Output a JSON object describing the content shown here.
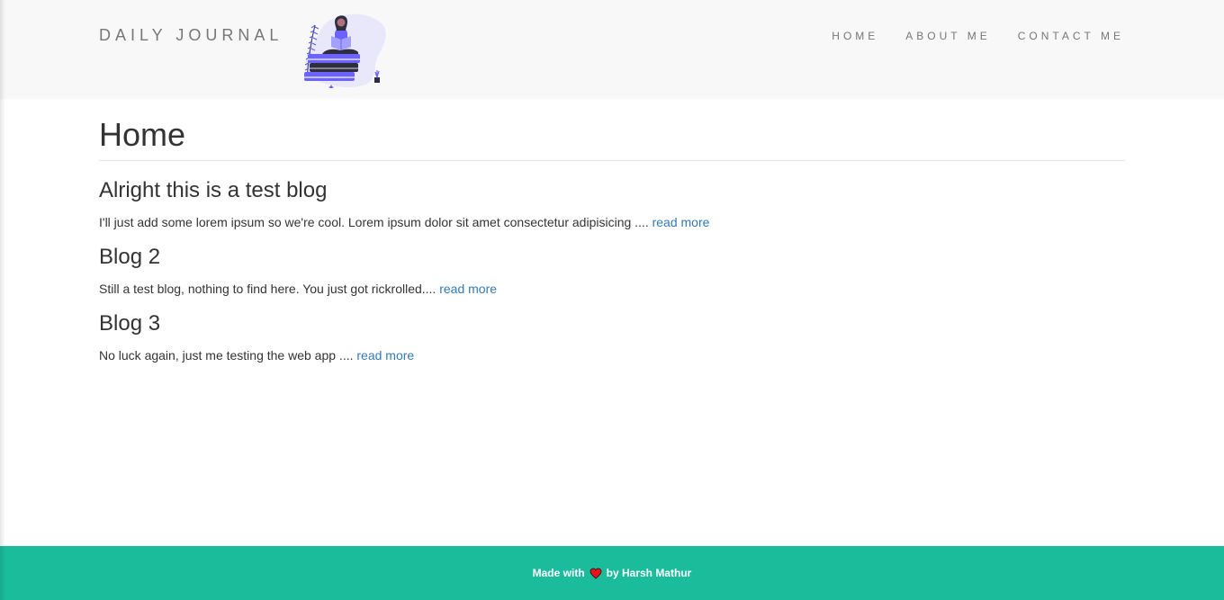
{
  "navbar": {
    "brand": "DAILY JOURNAL",
    "links": [
      "HOME",
      "ABOUT ME",
      "CONTACT ME"
    ]
  },
  "main": {
    "title": "Home",
    "posts": [
      {
        "title": "Alright this is a test blog",
        "excerpt": "I'll just add some lorem ipsum so we're cool. Lorem ipsum dolor sit amet consectetur adipisicing ....",
        "link": "read more"
      },
      {
        "title": "Blog 2",
        "excerpt": "Still a test blog, nothing to find here. You just got rickrolled....",
        "link": "read more"
      },
      {
        "title": "Blog 3",
        "excerpt": "No luck again, just me testing the web app ....",
        "link": "read more"
      }
    ]
  },
  "footer": {
    "prefix": "Made with",
    "suffix": "by Harsh Mathur",
    "icon": "heart-icon"
  },
  "colors": {
    "navbar_bg": "#f8f8f8",
    "footer_bg": "#1abc9c",
    "link": "#337ab7",
    "heart": "#e4161b",
    "illustration_accent": "#6c63ff"
  }
}
